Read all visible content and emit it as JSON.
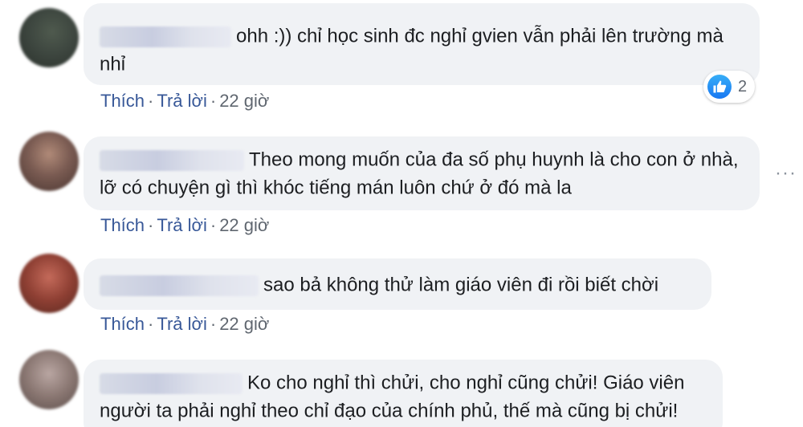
{
  "comments": [
    {
      "text": "ohh :)) chỉ học sinh đc nghỉ gvien vẫn phải lên trường mà nhỉ",
      "actions": {
        "like": "Thích",
        "reply": "Trả lời",
        "separator": "·",
        "time": "22 giờ"
      },
      "reaction": {
        "icon": "like-icon",
        "count": "2",
        "color": "#1877f2"
      }
    },
    {
      "text": "Theo mong muốn của đa số phụ huynh là cho con ở nhà, lỡ có chuyện gì thì khóc tiếng mán luôn chứ ở đó mà la",
      "actions": {
        "like": "Thích",
        "reply": "Trả lời",
        "separator": "·",
        "time": "22 giờ"
      }
    },
    {
      "text": "sao bả không thử làm giáo viên đi rồi biết chời",
      "actions": {
        "like": "Thích",
        "reply": "Trả lời",
        "separator": "·",
        "time": "22 giờ"
      }
    },
    {
      "text": "Ko cho nghỉ thì chửi, cho nghỉ cũng chửi! Giáo viên người ta phải nghỉ theo chỉ đạo của chính phủ, thế mà cũng bị chửi!"
    }
  ],
  "more_icon": {
    "icon": "more-horizontal-icon",
    "glyph": "···"
  },
  "colors": {
    "link": "#385898",
    "bubble": "#f0f2f5",
    "meta": "#606770",
    "like": "#1877f2"
  }
}
